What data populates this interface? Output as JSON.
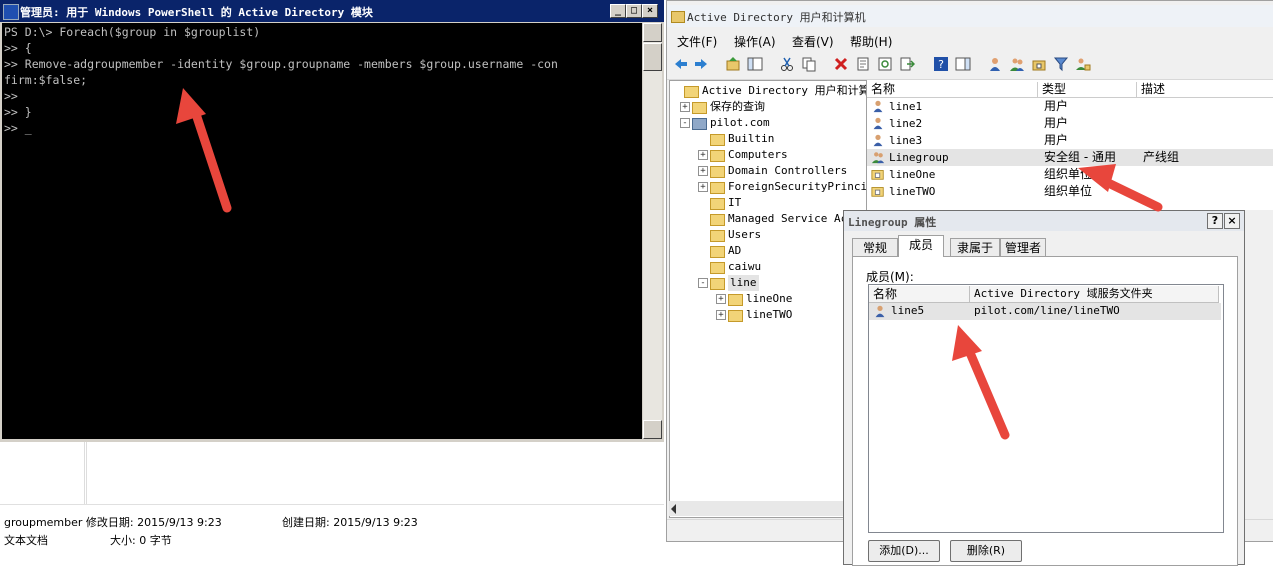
{
  "powershell": {
    "title": "管理员: 用于 Windows PowerShell 的 Active Directory 模块",
    "lines": [
      "PS D:\\> Foreach($group in $grouplist)",
      ">> {",
      ">> Remove-adgroupmember -identity $group.groupname -members $group.username -con",
      "firm:$false;",
      ">>",
      ">> }",
      ">> _"
    ]
  },
  "file_info": {
    "name_modified": "groupmember 修改日期: 2015/9/13 9:23",
    "created": "创建日期: 2015/9/13 9:23",
    "type": "文本文档",
    "size": "大小: 0 字节"
  },
  "ad_window": {
    "title": "Active Directory 用户和计算机",
    "menu": [
      "文件(F)",
      "操作(A)",
      "查看(V)",
      "帮助(H)"
    ],
    "tree": [
      {
        "label": "Active Directory 用户和计算机",
        "indent": 0,
        "expander": ""
      },
      {
        "label": "保存的查询",
        "indent": 1,
        "expander": "+"
      },
      {
        "label": "pilot.com",
        "indent": 1,
        "expander": "-"
      },
      {
        "label": "Builtin",
        "indent": 2,
        "expander": ""
      },
      {
        "label": "Computers",
        "indent": 2,
        "expander": "+"
      },
      {
        "label": "Domain Controllers",
        "indent": 2,
        "expander": "+"
      },
      {
        "label": "ForeignSecurityPrincip",
        "indent": 2,
        "expander": "+"
      },
      {
        "label": "IT",
        "indent": 2,
        "expander": ""
      },
      {
        "label": "Managed Service Acc",
        "indent": 2,
        "expander": ""
      },
      {
        "label": "Users",
        "indent": 2,
        "expander": ""
      },
      {
        "label": "AD",
        "indent": 2,
        "expander": ""
      },
      {
        "label": "caiwu",
        "indent": 2,
        "expander": ""
      },
      {
        "label": "line",
        "indent": 2,
        "expander": "-"
      },
      {
        "label": "lineOne",
        "indent": 3,
        "expander": "+"
      },
      {
        "label": "lineTWO",
        "indent": 3,
        "expander": "+"
      }
    ],
    "columns": [
      "名称",
      "类型",
      "描述"
    ],
    "rows": [
      {
        "name": "line1",
        "type": "用户",
        "desc": "",
        "icon": "user-icon"
      },
      {
        "name": "line2",
        "type": "用户",
        "desc": "",
        "icon": "user-icon"
      },
      {
        "name": "line3",
        "type": "用户",
        "desc": "",
        "icon": "user-icon"
      },
      {
        "name": "Linegroup",
        "type": "安全组 - 通用",
        "desc": "产线组",
        "icon": "group-icon"
      },
      {
        "name": "lineOne",
        "type": "组织单位",
        "desc": "",
        "icon": "ou-icon"
      },
      {
        "name": "lineTWO",
        "type": "组织单位",
        "desc": "",
        "icon": "ou-icon"
      }
    ]
  },
  "dialog": {
    "title": "Linegroup 属性",
    "tabs": [
      "常规",
      "成员",
      "隶属于",
      "管理者"
    ],
    "active_tab": "成员",
    "members_label": "成员(M):",
    "columns": [
      "名称",
      "Active Directory 域服务文件夹"
    ],
    "members": [
      {
        "name": "line5",
        "folder": "pilot.com/line/lineTWO"
      }
    ],
    "add_button": "添加(D)...",
    "remove_button": "删除(R)"
  },
  "colors": {
    "console_bg": "#000000",
    "console_fg": "#c0c0c0",
    "ps_titlebar": "#0a246a",
    "arrow": "#e8463c"
  }
}
